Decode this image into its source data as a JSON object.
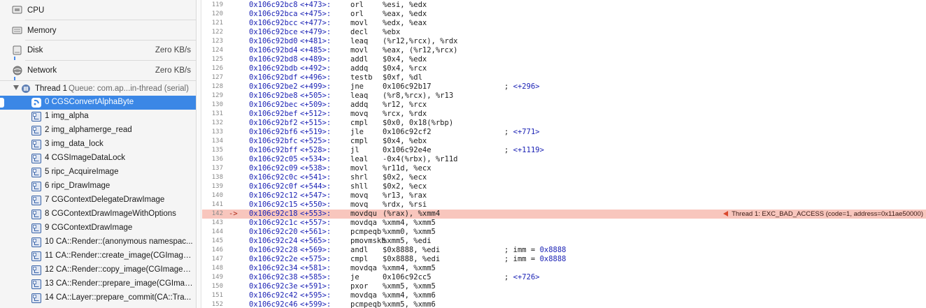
{
  "gauges": [
    {
      "label": "CPU",
      "value": "",
      "icon": "cpu-icon"
    },
    {
      "label": "Memory",
      "value": "",
      "icon": "memory-icon"
    },
    {
      "label": "Disk",
      "value": "Zero KB/s",
      "icon": "disk-icon"
    },
    {
      "label": "Network",
      "value": "Zero KB/s",
      "icon": "network-icon"
    }
  ],
  "thread": {
    "label": "Thread 1",
    "queue": "Queue: com.ap...in-thread (serial)"
  },
  "frames": [
    {
      "label": "0 CGSConvertAlphaByte",
      "selected": true
    },
    {
      "label": "1 img_alpha"
    },
    {
      "label": "2 img_alphamerge_read"
    },
    {
      "label": "3 img_data_lock"
    },
    {
      "label": "4 CGSImageDataLock"
    },
    {
      "label": "5 ripc_AcquireImage"
    },
    {
      "label": "6 ripc_DrawImage"
    },
    {
      "label": "7 CGContextDelegateDrawImage"
    },
    {
      "label": "8 CGContextDrawImageWithOptions"
    },
    {
      "label": "9 CGContextDrawImage"
    },
    {
      "label": "10 CA::Render::(anonymous namespac..."
    },
    {
      "label": "11 CA::Render::create_image(CGImage..."
    },
    {
      "label": "12 CA::Render::copy_image(CGImage*,..."
    },
    {
      "label": "13 CA::Render::prepare_image(CGImag..."
    },
    {
      "label": "14 CA::Layer::prepare_commit(CA::Tra..."
    }
  ],
  "disassembly": [
    {
      "ln": "119",
      "addr": "0x106c92bc8",
      "off": "<+473>:",
      "mn": "orl",
      "ops": "%esi, %edx",
      "cmt": "",
      "hex": ""
    },
    {
      "ln": "120",
      "addr": "0x106c92bca",
      "off": "<+475>:",
      "mn": "orl",
      "ops": "%eax, %edx",
      "cmt": "",
      "hex": ""
    },
    {
      "ln": "121",
      "addr": "0x106c92bcc",
      "off": "<+477>:",
      "mn": "movl",
      "ops": "%edx, %eax",
      "cmt": "",
      "hex": ""
    },
    {
      "ln": "122",
      "addr": "0x106c92bce",
      "off": "<+479>:",
      "mn": "decl",
      "ops": "%ebx",
      "cmt": "",
      "hex": ""
    },
    {
      "ln": "123",
      "addr": "0x106c92bd0",
      "off": "<+481>:",
      "mn": "leaq",
      "ops": "(%r12,%rcx), %rdx",
      "cmt": "",
      "hex": ""
    },
    {
      "ln": "124",
      "addr": "0x106c92bd4",
      "off": "<+485>:",
      "mn": "movl",
      "ops": "%eax, (%r12,%rcx)",
      "cmt": "",
      "hex": ""
    },
    {
      "ln": "125",
      "addr": "0x106c92bd8",
      "off": "<+489>:",
      "mn": "addl",
      "ops": "$0x4, %edx",
      "cmt": "",
      "hex": ""
    },
    {
      "ln": "126",
      "addr": "0x106c92bdb",
      "off": "<+492>:",
      "mn": "addq",
      "ops": "$0x4, %rcx",
      "cmt": "",
      "hex": ""
    },
    {
      "ln": "127",
      "addr": "0x106c92bdf",
      "off": "<+496>:",
      "mn": "testb",
      "ops": "$0xf, %dl",
      "cmt": "",
      "hex": ""
    },
    {
      "ln": "128",
      "addr": "0x106c92be2",
      "off": "<+499>:",
      "mn": "jne",
      "ops": "0x106c92b17",
      "cmt": "; ",
      "hex": "<+296>"
    },
    {
      "ln": "129",
      "addr": "0x106c92be8",
      "off": "<+505>:",
      "mn": "leaq",
      "ops": "(%r8,%rcx), %r13",
      "cmt": "",
      "hex": ""
    },
    {
      "ln": "130",
      "addr": "0x106c92bec",
      "off": "<+509>:",
      "mn": "addq",
      "ops": "%r12, %rcx",
      "cmt": "",
      "hex": ""
    },
    {
      "ln": "131",
      "addr": "0x106c92bef",
      "off": "<+512>:",
      "mn": "movq",
      "ops": "%rcx, %rdx",
      "cmt": "",
      "hex": ""
    },
    {
      "ln": "132",
      "addr": "0x106c92bf2",
      "off": "<+515>:",
      "mn": "cmpl",
      "ops": "$0x0, 0x18(%rbp)",
      "cmt": "",
      "hex": ""
    },
    {
      "ln": "133",
      "addr": "0x106c92bf6",
      "off": "<+519>:",
      "mn": "jle",
      "ops": "0x106c92cf2",
      "cmt": "; ",
      "hex": "<+771>"
    },
    {
      "ln": "134",
      "addr": "0x106c92bfc",
      "off": "<+525>:",
      "mn": "cmpl",
      "ops": "$0x4, %ebx",
      "cmt": "",
      "hex": ""
    },
    {
      "ln": "135",
      "addr": "0x106c92bff",
      "off": "<+528>:",
      "mn": "jl",
      "ops": "0x106c92e4e",
      "cmt": "; ",
      "hex": "<+1119>"
    },
    {
      "ln": "136",
      "addr": "0x106c92c05",
      "off": "<+534>:",
      "mn": "leal",
      "ops": "-0x4(%rbx), %r11d",
      "cmt": "",
      "hex": ""
    },
    {
      "ln": "137",
      "addr": "0x106c92c09",
      "off": "<+538>:",
      "mn": "movl",
      "ops": "%r11d, %ecx",
      "cmt": "",
      "hex": ""
    },
    {
      "ln": "138",
      "addr": "0x106c92c0c",
      "off": "<+541>:",
      "mn": "shrl",
      "ops": "$0x2, %ecx",
      "cmt": "",
      "hex": ""
    },
    {
      "ln": "139",
      "addr": "0x106c92c0f",
      "off": "<+544>:",
      "mn": "shll",
      "ops": "$0x2, %ecx",
      "cmt": "",
      "hex": ""
    },
    {
      "ln": "140",
      "addr": "0x106c92c12",
      "off": "<+547>:",
      "mn": "movq",
      "ops": "%r13, %rax",
      "cmt": "",
      "hex": ""
    },
    {
      "ln": "141",
      "addr": "0x106c92c15",
      "off": "<+550>:",
      "mn": "movq",
      "ops": "%rdx, %rsi",
      "cmt": "",
      "hex": ""
    },
    {
      "ln": "142",
      "addr": "0x106c92c18",
      "off": "<+553>:",
      "mn": "movdqu",
      "ops": "(%rax), %xmm4",
      "cmt": "",
      "hex": "",
      "crash": true,
      "arrow": "->"
    },
    {
      "ln": "143",
      "addr": "0x106c92c1c",
      "off": "<+557>:",
      "mn": "movdqa",
      "ops": "%xmm4, %xmm5",
      "cmt": "",
      "hex": ""
    },
    {
      "ln": "144",
      "addr": "0x106c92c20",
      "off": "<+561>:",
      "mn": "pcmpeqb",
      "ops": "%xmm0, %xmm5",
      "cmt": "",
      "hex": ""
    },
    {
      "ln": "145",
      "addr": "0x106c92c24",
      "off": "<+565>:",
      "mn": "pmovmskb",
      "ops": "%xmm5, %edi",
      "cmt": "",
      "hex": ""
    },
    {
      "ln": "146",
      "addr": "0x106c92c28",
      "off": "<+569>:",
      "mn": "andl",
      "ops": "$0x8888, %edi",
      "cmt": "; imm = ",
      "hex": "0x8888"
    },
    {
      "ln": "147",
      "addr": "0x106c92c2e",
      "off": "<+575>:",
      "mn": "cmpl",
      "ops": "$0x8888, %edi",
      "cmt": "; imm = ",
      "hex": "0x8888"
    },
    {
      "ln": "148",
      "addr": "0x106c92c34",
      "off": "<+581>:",
      "mn": "movdqa",
      "ops": "%xmm4, %xmm5",
      "cmt": "",
      "hex": ""
    },
    {
      "ln": "149",
      "addr": "0x106c92c38",
      "off": "<+585>:",
      "mn": "je",
      "ops": "0x106c92cc5",
      "cmt": "; ",
      "hex": "<+726>"
    },
    {
      "ln": "150",
      "addr": "0x106c92c3e",
      "off": "<+591>:",
      "mn": "pxor",
      "ops": "%xmm5, %xmm5",
      "cmt": "",
      "hex": ""
    },
    {
      "ln": "151",
      "addr": "0x106c92c42",
      "off": "<+595>:",
      "mn": "movdqa",
      "ops": "%xmm4, %xmm6",
      "cmt": "",
      "hex": ""
    },
    {
      "ln": "152",
      "addr": "0x106c92c46",
      "off": "<+599>:",
      "mn": "pcmpeqb",
      "ops": "%xmm5, %xmm6",
      "cmt": "",
      "hex": ""
    }
  ],
  "crash_message": "Thread 1: EXC_BAD_ACCESS (code=1, address=0x11ae50000)",
  "colors": {
    "selection": "#3b87e6",
    "crash_line": "#f8c6bd",
    "address": "#1c23b5",
    "crash_flag": "#d9492e"
  }
}
